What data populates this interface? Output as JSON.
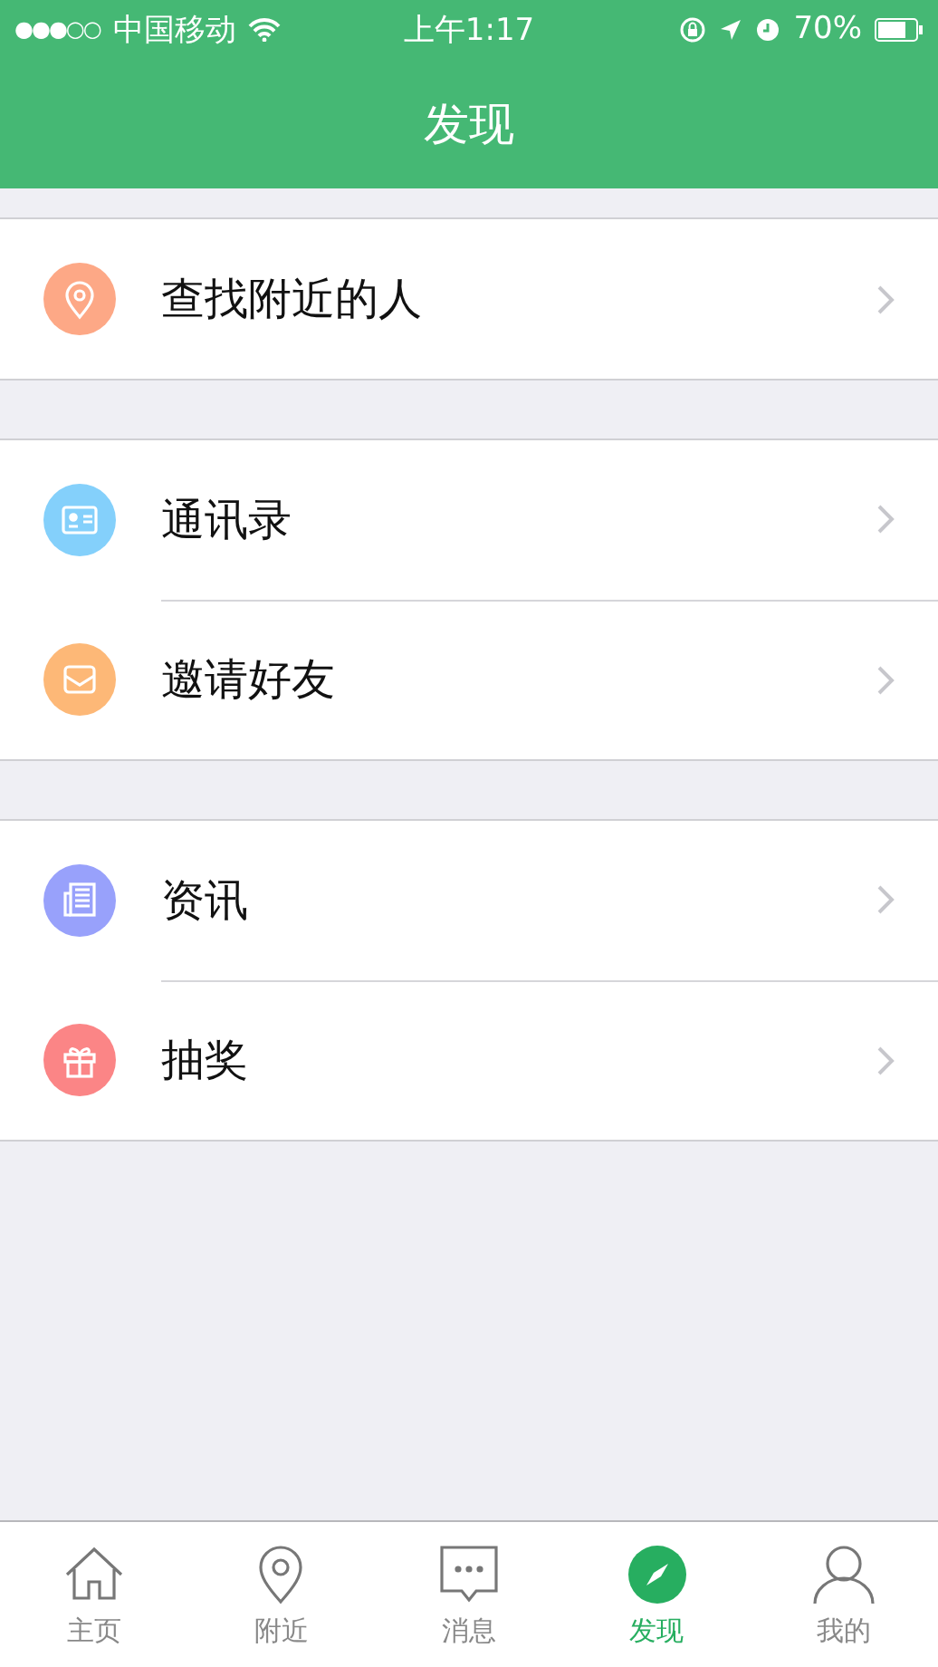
{
  "status_bar": {
    "signal": "●●●○○",
    "carrier": "中国移动",
    "time": "上午1:17",
    "battery": "70%"
  },
  "nav": {
    "title": "发现"
  },
  "groups": [
    {
      "items": [
        {
          "kind": "pin",
          "label": "查找附近的人",
          "color": "#fda886"
        }
      ]
    },
    {
      "items": [
        {
          "kind": "card",
          "label": "通讯录",
          "color": "#84d0fb"
        },
        {
          "kind": "mail",
          "label": "邀请好友",
          "color": "#fdb877"
        }
      ]
    },
    {
      "items": [
        {
          "kind": "news",
          "label": "资讯",
          "color": "#98a1fb"
        },
        {
          "kind": "gift",
          "label": "抽奖",
          "color": "#fb8586"
        }
      ]
    }
  ],
  "tabs": [
    {
      "kind": "home",
      "label": "主页",
      "selected": false
    },
    {
      "kind": "pin",
      "label": "附近",
      "selected": false
    },
    {
      "kind": "chat",
      "label": "消息",
      "selected": false
    },
    {
      "kind": "compass",
      "label": "发现",
      "selected": true
    },
    {
      "kind": "person",
      "label": "我的",
      "selected": false
    }
  ]
}
